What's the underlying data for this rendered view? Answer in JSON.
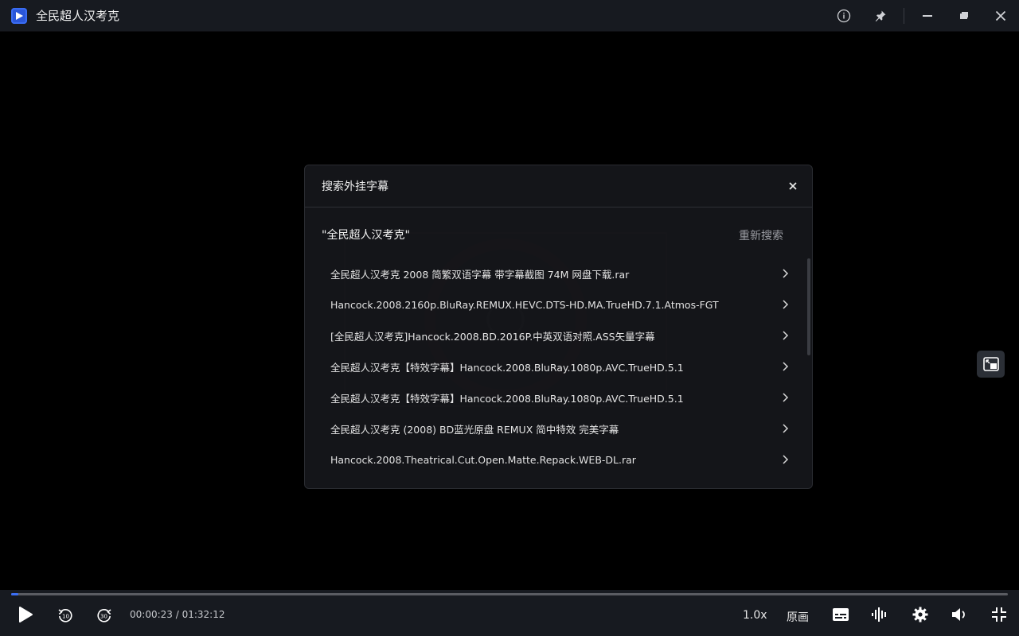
{
  "window": {
    "title": "全民超人汉考克",
    "icons": [
      "info-icon",
      "pin-icon",
      "minimize-icon",
      "restore-icon",
      "close-icon"
    ]
  },
  "dialog": {
    "title": "搜索外挂字幕",
    "query": "\"全民超人汉考克\"",
    "research_label": "重新搜索",
    "results": [
      "全民超人汉考克 2008 简繁双语字幕 带字幕截图 74M 网盘下载.rar",
      "Hancock.2008.2160p.BluRay.REMUX.HEVC.DTS-HD.MA.TrueHD.7.1.Atmos-FGT",
      "[全民超人汉考克]Hancock.2008.BD.2016P.中英双语对照.ASS矢量字幕",
      "全民超人汉考克【特效字幕】Hancock.2008.BluRay.1080p.AVC.TrueHD.5.1",
      "全民超人汉考克【特效字幕】Hancock.2008.BluRay.1080p.AVC.TrueHD.5.1",
      "全民超人汉考克 (2008) BD蓝光原盘 REMUX 简中特效 完美字幕",
      "Hancock.2008.Theatrical.Cut.Open.Matte.Repack.WEB-DL.rar"
    ]
  },
  "player": {
    "time": "00:00:23 / 01:32:12",
    "progress": 0.0042,
    "rate": "1.0x",
    "quality": "原画",
    "accent": "#3b6ef5"
  }
}
